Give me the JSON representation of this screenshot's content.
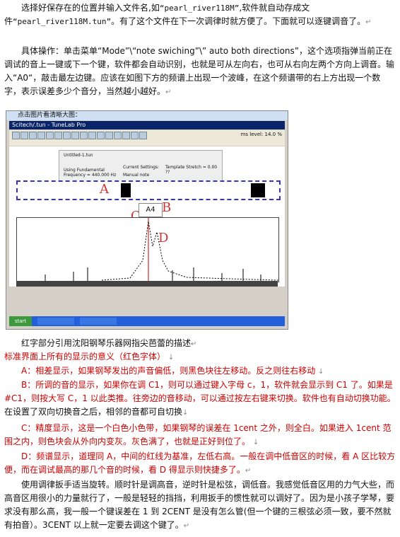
{
  "paragraph1": {
    "part1": "选择好保存在的位置并输入文件名,如",
    "filename1": "“pearl_river118M”",
    "part2": ",软件就自动存成文件",
    "filename2": "“pearl_river118M.tun”",
    "part3": "。有了这个文件在下一次调律时就方便了。下面就可以逐键调音了。"
  },
  "paragraph2": "具体操作：单击菜单“Mode”\\“note swiching”\\” auto both directions”，这个选项指弹当前正在调试的音上一键或下一个键，软件都会自动识别，也就是可从左向右，也可从右向左两个方向上调音。输入“A0“，敲击最左边键。应该在如图下方的频谱上出现一个波峰，在这个频谱带的右上方出现一个数字，表示误差多少个音分，当然越小越好。",
  "screenshot": {
    "caption": "点击图片看清晰大图：",
    "app_title": "Scitech/.tun - TuneLab Pro",
    "level": "ms level: 14.0 %",
    "info_line1": "Untitled-1.tun",
    "info_line2": "Using Fundamental",
    "info_line3": "Frequency = 440.000 Hz",
    "info_current": "Current Settings:",
    "info_manual": "Manual note",
    "info_stretch": "Template Stretch = 0.00 ??",
    "label_a": "A",
    "label_b": "B",
    "label_c": "C",
    "label_d": "D",
    "note": "A4",
    "start": "start"
  },
  "paragraph3": "红字部分引用沈阳钢琴乐器网指尖芭蕾的描述",
  "red_heading": "标准界面上所有的显示的意义（红色字体）",
  "red_items": {
    "a": "A：相差显示，如果钢琴发出的声音偏低，则黑色块往左移动。反之则往右移动",
    "b1": "B：所调的音的显示，如果你在调 C1，则可以通过键入字母 c，1，软件就会显示到 C1 了。如果是#C1，则按大写 C，1 以此类推。往旁边的音移动，可以通过按左右键来切换。软件也有自动切换功能。",
    "b2": "在设置了双向切换音之后，相邻的音都可自切换",
    "c": "C：精度显示，这是一个白色小色带，如果钢琴的误差在 1cent 之外，则全白。如果进入 1cent 范围之内，则色块会从外向内变灰。灰色满了，也就是正好到位了。",
    "d": "D：频谱显示，道理同 A，中间的红线为基准，左低右高。一般在调中低音区的时候，看 A 区比较方便，而在调试最高的那几个音的时候，看 D 得显示则快捷多了。"
  },
  "paragraph4": "使用调律扳手适当旋转。顺时针是调高音，逆时针是松弦，调低音。我感觉低音区用的力气大些，而高音区用很小的力量就行了，一般是轻轻的挡挡，利用扳手的惯性就可以调好了。因为是小孩子学琴，要求没有那么高，我一般一个键误差在 1 到 2CENT 是没有怎么管(但一个键的三根弦必须一致，要不然就有拍音）。3CENT 以上就一定要去调这个键了。"
}
